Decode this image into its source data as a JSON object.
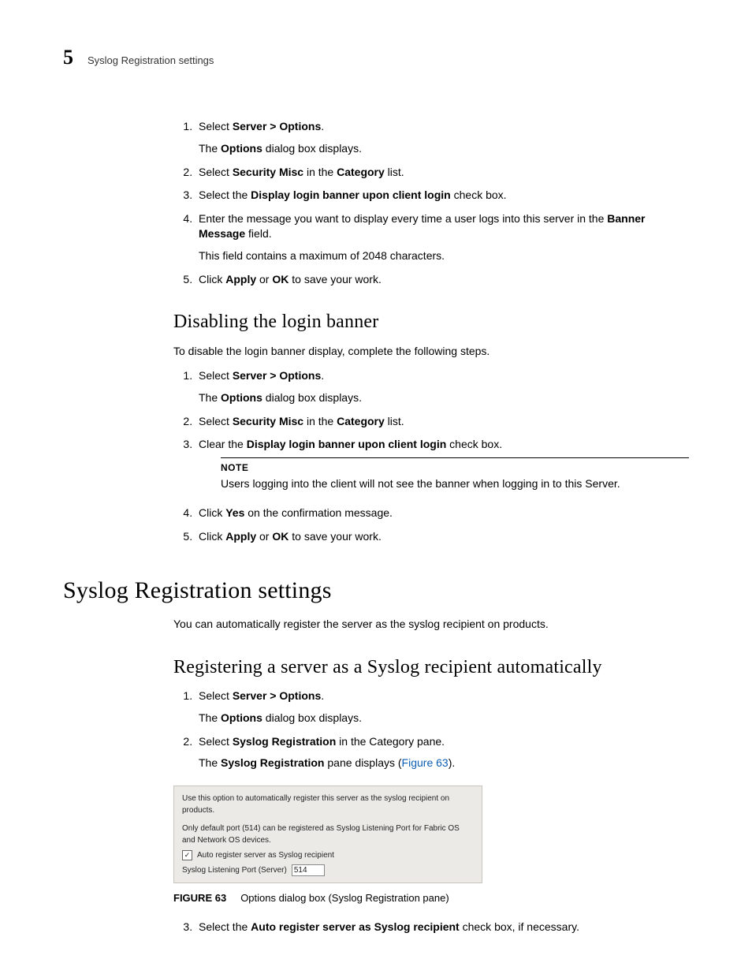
{
  "header": {
    "chapter_number": "5",
    "running_title": "Syslog Registration settings"
  },
  "list_a": {
    "items": [
      {
        "n": "1.",
        "prefix": "Select ",
        "bold": "Server > Options",
        "suffix": ".",
        "sub_prefix": "The ",
        "sub_bold": "Options",
        "sub_suffix": " dialog box displays."
      },
      {
        "n": "2.",
        "prefix": "Select ",
        "bold": "Security Misc",
        "mid": " in the ",
        "bold2": "Category",
        "suffix": " list."
      },
      {
        "n": "3.",
        "prefix": "Select the ",
        "bold": "Display login banner upon client login",
        "suffix": " check box."
      },
      {
        "n": "4.",
        "prefix": "Enter the message you want to display every time a user logs into this server in the ",
        "bold": "Banner Message",
        "suffix": " field.",
        "sub_plain": "This field contains a maximum of 2048 characters."
      },
      {
        "n": "5.",
        "prefix": "Click ",
        "bold": "Apply",
        "mid": " or ",
        "bold2": "OK",
        "suffix": " to save your work."
      }
    ]
  },
  "section_b": {
    "heading": "Disabling the login banner",
    "intro": "To disable the login banner display, complete the following steps.",
    "items": [
      {
        "n": "1.",
        "prefix": "Select ",
        "bold": "Server > Options",
        "suffix": ".",
        "sub_prefix": "The ",
        "sub_bold": "Options",
        "sub_suffix": " dialog box displays."
      },
      {
        "n": "2.",
        "prefix": "Select ",
        "bold": "Security Misc",
        "mid": " in the ",
        "bold2": "Category",
        "suffix": " list."
      },
      {
        "n": "3.",
        "prefix": "Clear the ",
        "bold": "Display login banner upon client login",
        "suffix": " check box."
      }
    ],
    "note_label": "NOTE",
    "note_text": "Users logging into the client will not see the banner when logging in to this Server.",
    "items_after": [
      {
        "n": "4.",
        "prefix": "Click ",
        "bold": "Yes",
        "suffix": " on the confirmation message."
      },
      {
        "n": "5.",
        "prefix": "Click ",
        "bold": "Apply",
        "mid": " or ",
        "bold2": "OK",
        "suffix": " to save your work."
      }
    ]
  },
  "major": {
    "heading": "Syslog Registration settings",
    "intro": "You can automatically register the server as the syslog recipient on products."
  },
  "section_c": {
    "heading": "Registering a server as a Syslog recipient automatically",
    "items": [
      {
        "n": "1.",
        "prefix": "Select ",
        "bold": "Server > Options",
        "suffix": ".",
        "sub_prefix": "The ",
        "sub_bold": "Options",
        "sub_suffix": " dialog box displays."
      },
      {
        "n": "2.",
        "prefix": "Select ",
        "bold": "Syslog Registration",
        "suffix": " in the Category pane.",
        "sub_prefix": "The ",
        "sub_bold": "Syslog Registration",
        "sub_suffix": " pane displays (",
        "sub_link": "Figure 63",
        "sub_tail": ")."
      }
    ],
    "figure": {
      "line1": "Use this option to automatically register this server as the syslog recipient on products.",
      "line2": "Only default port (514) can be registered as Syslog Listening Port for Fabric OS and Network OS devices.",
      "checkbox_label": "Auto register server as Syslog recipient",
      "port_label": "Syslog Listening Port (Server)",
      "port_value": "514",
      "caption_label": "FIGURE 63",
      "caption_text": "Options dialog box (Syslog Registration pane)"
    },
    "items_after": [
      {
        "n": "3.",
        "prefix": "Select the ",
        "bold": "Auto register server as Syslog recipient",
        "suffix": " check box, if necessary."
      }
    ]
  }
}
